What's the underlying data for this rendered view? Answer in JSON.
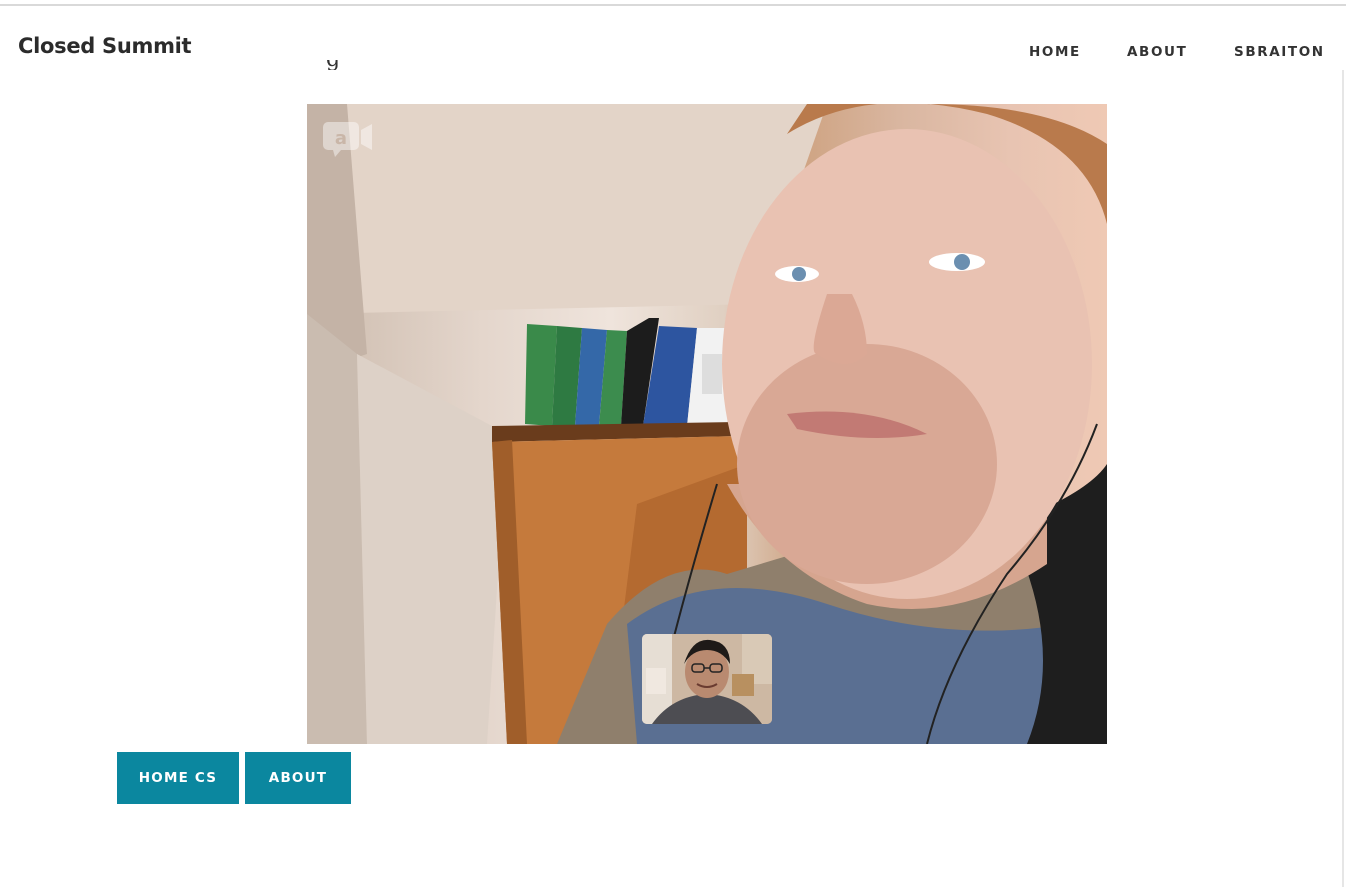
{
  "header": {
    "brand": "Closed Summit",
    "nav": {
      "home": "HOME",
      "about": "ABOUT",
      "user": "SBRAITON"
    }
  },
  "content": {
    "cut_off_text": "g"
  },
  "video_call": {
    "overlay_icon": "appear-in-logo-icon",
    "self_view": "picture-in-picture-camera"
  },
  "buttons": {
    "home_cs": "HOME CS",
    "about": "ABOUT"
  },
  "colors": {
    "button": "#0b879f",
    "brand_text": "#2b2b2b",
    "nav_text": "#333333"
  }
}
